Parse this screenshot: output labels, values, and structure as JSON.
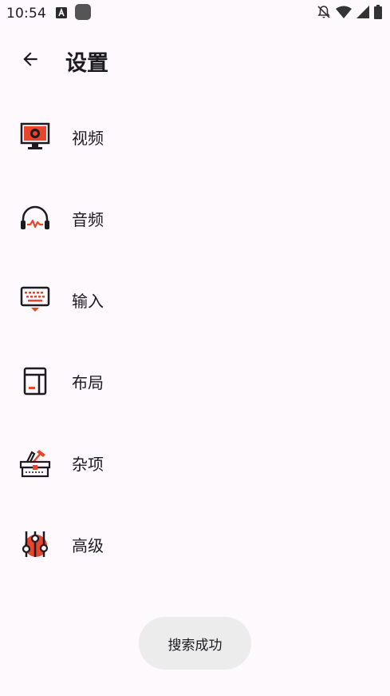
{
  "status_bar": {
    "time": "10:54",
    "icons": [
      "font-a-icon",
      "app-square-icon",
      "notifications-off-icon",
      "wifi-icon",
      "signal-icon",
      "battery-icon"
    ]
  },
  "app_bar": {
    "title": "设置",
    "back_icon": "arrow-back-icon"
  },
  "menu": {
    "items": [
      {
        "label": "视频",
        "icon": "video-icon"
      },
      {
        "label": "音频",
        "icon": "headphones-icon"
      },
      {
        "label": "输入",
        "icon": "keyboard-icon"
      },
      {
        "label": "布局",
        "icon": "layout-icon"
      },
      {
        "label": "杂项",
        "icon": "toolbox-icon"
      },
      {
        "label": "高级",
        "icon": "sliders-icon"
      }
    ]
  },
  "toast": {
    "message": "搜索成功"
  },
  "colors": {
    "background": "#fdf9fd",
    "accent": "#e8452c",
    "text": "#1c1b1f",
    "toast_bg": "#ececec"
  }
}
